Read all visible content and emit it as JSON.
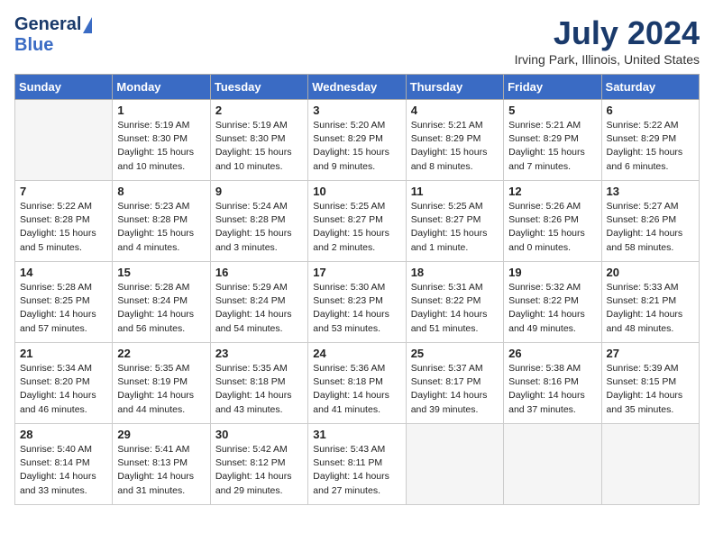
{
  "header": {
    "logo_general": "General",
    "logo_blue": "Blue",
    "month_year": "July 2024",
    "location": "Irving Park, Illinois, United States"
  },
  "days_of_week": [
    "Sunday",
    "Monday",
    "Tuesday",
    "Wednesday",
    "Thursday",
    "Friday",
    "Saturday"
  ],
  "weeks": [
    [
      {
        "day": "",
        "info": ""
      },
      {
        "day": "1",
        "info": "Sunrise: 5:19 AM\nSunset: 8:30 PM\nDaylight: 15 hours\nand 10 minutes."
      },
      {
        "day": "2",
        "info": "Sunrise: 5:19 AM\nSunset: 8:30 PM\nDaylight: 15 hours\nand 10 minutes."
      },
      {
        "day": "3",
        "info": "Sunrise: 5:20 AM\nSunset: 8:29 PM\nDaylight: 15 hours\nand 9 minutes."
      },
      {
        "day": "4",
        "info": "Sunrise: 5:21 AM\nSunset: 8:29 PM\nDaylight: 15 hours\nand 8 minutes."
      },
      {
        "day": "5",
        "info": "Sunrise: 5:21 AM\nSunset: 8:29 PM\nDaylight: 15 hours\nand 7 minutes."
      },
      {
        "day": "6",
        "info": "Sunrise: 5:22 AM\nSunset: 8:29 PM\nDaylight: 15 hours\nand 6 minutes."
      }
    ],
    [
      {
        "day": "7",
        "info": "Sunrise: 5:22 AM\nSunset: 8:28 PM\nDaylight: 15 hours\nand 5 minutes."
      },
      {
        "day": "8",
        "info": "Sunrise: 5:23 AM\nSunset: 8:28 PM\nDaylight: 15 hours\nand 4 minutes."
      },
      {
        "day": "9",
        "info": "Sunrise: 5:24 AM\nSunset: 8:28 PM\nDaylight: 15 hours\nand 3 minutes."
      },
      {
        "day": "10",
        "info": "Sunrise: 5:25 AM\nSunset: 8:27 PM\nDaylight: 15 hours\nand 2 minutes."
      },
      {
        "day": "11",
        "info": "Sunrise: 5:25 AM\nSunset: 8:27 PM\nDaylight: 15 hours\nand 1 minute."
      },
      {
        "day": "12",
        "info": "Sunrise: 5:26 AM\nSunset: 8:26 PM\nDaylight: 15 hours\nand 0 minutes."
      },
      {
        "day": "13",
        "info": "Sunrise: 5:27 AM\nSunset: 8:26 PM\nDaylight: 14 hours\nand 58 minutes."
      }
    ],
    [
      {
        "day": "14",
        "info": "Sunrise: 5:28 AM\nSunset: 8:25 PM\nDaylight: 14 hours\nand 57 minutes."
      },
      {
        "day": "15",
        "info": "Sunrise: 5:28 AM\nSunset: 8:24 PM\nDaylight: 14 hours\nand 56 minutes."
      },
      {
        "day": "16",
        "info": "Sunrise: 5:29 AM\nSunset: 8:24 PM\nDaylight: 14 hours\nand 54 minutes."
      },
      {
        "day": "17",
        "info": "Sunrise: 5:30 AM\nSunset: 8:23 PM\nDaylight: 14 hours\nand 53 minutes."
      },
      {
        "day": "18",
        "info": "Sunrise: 5:31 AM\nSunset: 8:22 PM\nDaylight: 14 hours\nand 51 minutes."
      },
      {
        "day": "19",
        "info": "Sunrise: 5:32 AM\nSunset: 8:22 PM\nDaylight: 14 hours\nand 49 minutes."
      },
      {
        "day": "20",
        "info": "Sunrise: 5:33 AM\nSunset: 8:21 PM\nDaylight: 14 hours\nand 48 minutes."
      }
    ],
    [
      {
        "day": "21",
        "info": "Sunrise: 5:34 AM\nSunset: 8:20 PM\nDaylight: 14 hours\nand 46 minutes."
      },
      {
        "day": "22",
        "info": "Sunrise: 5:35 AM\nSunset: 8:19 PM\nDaylight: 14 hours\nand 44 minutes."
      },
      {
        "day": "23",
        "info": "Sunrise: 5:35 AM\nSunset: 8:18 PM\nDaylight: 14 hours\nand 43 minutes."
      },
      {
        "day": "24",
        "info": "Sunrise: 5:36 AM\nSunset: 8:18 PM\nDaylight: 14 hours\nand 41 minutes."
      },
      {
        "day": "25",
        "info": "Sunrise: 5:37 AM\nSunset: 8:17 PM\nDaylight: 14 hours\nand 39 minutes."
      },
      {
        "day": "26",
        "info": "Sunrise: 5:38 AM\nSunset: 8:16 PM\nDaylight: 14 hours\nand 37 minutes."
      },
      {
        "day": "27",
        "info": "Sunrise: 5:39 AM\nSunset: 8:15 PM\nDaylight: 14 hours\nand 35 minutes."
      }
    ],
    [
      {
        "day": "28",
        "info": "Sunrise: 5:40 AM\nSunset: 8:14 PM\nDaylight: 14 hours\nand 33 minutes."
      },
      {
        "day": "29",
        "info": "Sunrise: 5:41 AM\nSunset: 8:13 PM\nDaylight: 14 hours\nand 31 minutes."
      },
      {
        "day": "30",
        "info": "Sunrise: 5:42 AM\nSunset: 8:12 PM\nDaylight: 14 hours\nand 29 minutes."
      },
      {
        "day": "31",
        "info": "Sunrise: 5:43 AM\nSunset: 8:11 PM\nDaylight: 14 hours\nand 27 minutes."
      },
      {
        "day": "",
        "info": ""
      },
      {
        "day": "",
        "info": ""
      },
      {
        "day": "",
        "info": ""
      }
    ]
  ]
}
